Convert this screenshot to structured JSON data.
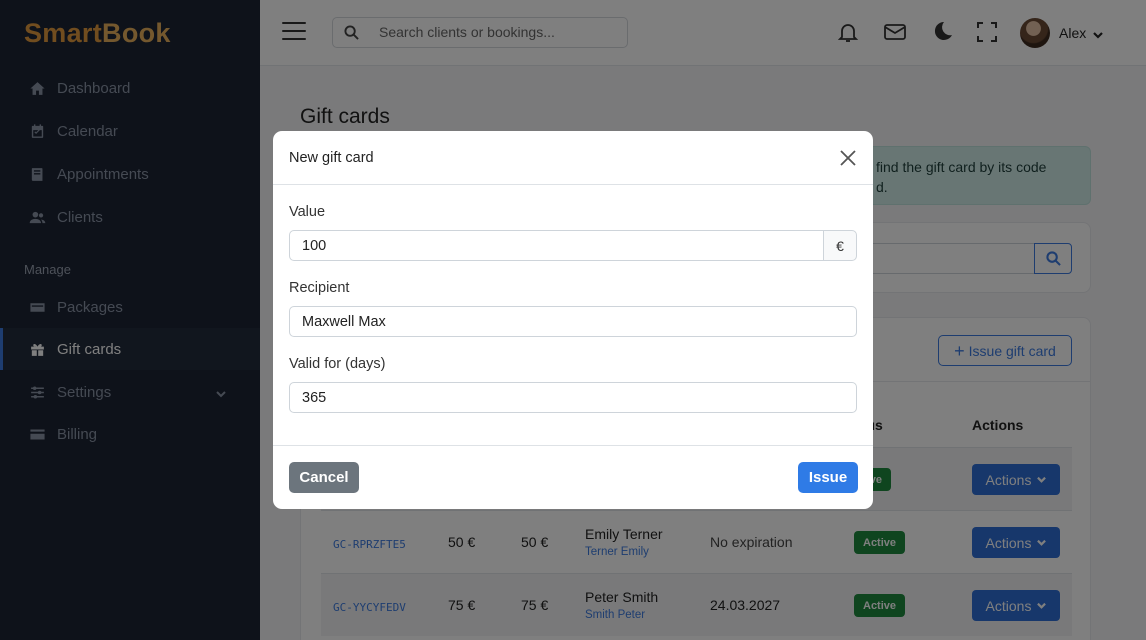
{
  "brand": {
    "part1": "Smart",
    "part2": "Book"
  },
  "sidebar": {
    "items": [
      {
        "label": "Dashboard",
        "icon": "home-icon"
      },
      {
        "label": "Calendar",
        "icon": "calendar-icon"
      },
      {
        "label": "Appointments",
        "icon": "book-icon"
      },
      {
        "label": "Clients",
        "icon": "users-icon"
      }
    ],
    "section_label": "Manage",
    "manage_items": [
      {
        "label": "Packages",
        "icon": "package-icon"
      },
      {
        "label": "Gift cards",
        "icon": "gift-icon",
        "active": true
      },
      {
        "label": "Settings",
        "icon": "sliders-icon",
        "has_submenu": true
      },
      {
        "label": "Billing",
        "icon": "credit-card-icon"
      }
    ]
  },
  "topbar": {
    "search_placeholder": "Search clients or bookings...",
    "user_name": "Alex"
  },
  "page": {
    "title": "Gift cards",
    "alert_line1": "find the gift card by its code",
    "alert_line2": "d.",
    "issue_button": "Issue gift card",
    "table_headers": {
      "status": "atus",
      "actions": "Actions"
    },
    "rows": [
      {
        "code": "",
        "value": "",
        "balance": "",
        "client": "",
        "client_sub": "",
        "expiry": "",
        "status": "tive",
        "action": "Actions"
      },
      {
        "code": "GC-RPRZFTE5",
        "value": "50 €",
        "balance": "50 €",
        "client": "Emily Terner",
        "client_sub": "Terner Emily",
        "expiry": "No expiration",
        "status": "Active",
        "action": "Actions"
      },
      {
        "code": "GC-YYCYFEDV",
        "value": "75 €",
        "balance": "75 €",
        "client": "Peter Smith",
        "client_sub": "Smith Peter",
        "expiry": "24.03.2027",
        "status": "Active",
        "action": "Actions"
      }
    ]
  },
  "modal": {
    "title": "New gift card",
    "value_label": "Value",
    "value": "100",
    "currency": "€",
    "recipient_label": "Recipient",
    "recipient": "Maxwell Max",
    "valid_label": "Valid for (days)",
    "valid_days": "365",
    "cancel_label": "Cancel",
    "issue_label": "Issue"
  },
  "colors": {
    "sidebar_bg": "#1c2434",
    "primary": "#2f7be6",
    "success": "#1f8a3e",
    "secondary": "#6c757d"
  }
}
